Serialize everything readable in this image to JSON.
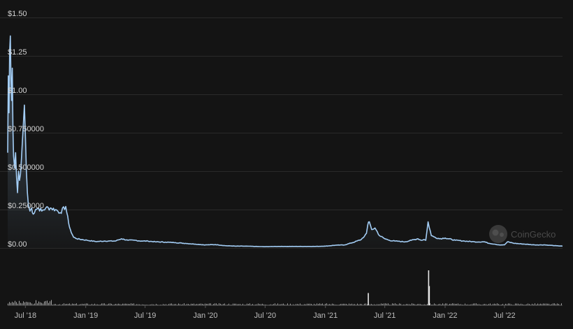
{
  "chart_data": {
    "type": "area",
    "y_tick_labels": [
      "$1.50",
      "$1.25",
      "$1.00",
      "$0.750000",
      "$0.500000",
      "$0.250000",
      "$0.00"
    ],
    "y_tick_values": [
      1.5,
      1.25,
      1.0,
      0.75,
      0.5,
      0.25,
      0.0
    ],
    "ylim": [
      0,
      1.5
    ],
    "x_tick_labels": [
      "Jul '18",
      "Jan '19",
      "Jul '19",
      "Jan '20",
      "Jul '20",
      "Jan '21",
      "Jul '21",
      "Jan '22",
      "Jul '22"
    ],
    "x_tick_values": [
      "2018-07-01",
      "2019-01-01",
      "2019-07-01",
      "2020-01-01",
      "2020-07-01",
      "2021-01-01",
      "2021-07-01",
      "2022-01-01",
      "2022-07-01"
    ],
    "xlim": [
      "2018-05-08",
      "2022-12-25"
    ],
    "grid": true,
    "line_color": "#a3cdf5",
    "volume_color": "#e8e8e8",
    "price_series": {
      "x": [
        "2018-05-08",
        "2018-05-10",
        "2018-05-12",
        "2018-05-14",
        "2018-05-16",
        "2018-05-18",
        "2018-05-20",
        "2018-05-22",
        "2018-05-24",
        "2018-05-26",
        "2018-05-29",
        "2018-06-01",
        "2018-06-04",
        "2018-06-07",
        "2018-06-10",
        "2018-06-13",
        "2018-06-16",
        "2018-06-19",
        "2018-06-22",
        "2018-06-25",
        "2018-06-28",
        "2018-07-01",
        "2018-07-04",
        "2018-07-07",
        "2018-07-10",
        "2018-07-15",
        "2018-07-20",
        "2018-07-25",
        "2018-08-01",
        "2018-08-10",
        "2018-08-20",
        "2018-09-01",
        "2018-09-15",
        "2018-10-01",
        "2018-10-15",
        "2018-11-01",
        "2018-11-10",
        "2018-11-18",
        "2018-11-25",
        "2018-12-05",
        "2018-12-20",
        "2019-01-05",
        "2019-02-01",
        "2019-03-01",
        "2019-04-01",
        "2019-04-20",
        "2019-05-10",
        "2019-06-01",
        "2019-06-20",
        "2019-07-10",
        "2019-08-01",
        "2019-09-01",
        "2019-10-01",
        "2019-11-01",
        "2019-12-01",
        "2020-01-01",
        "2020-02-01",
        "2020-03-01",
        "2020-04-01",
        "2020-05-01",
        "2020-06-01",
        "2020-07-01",
        "2020-08-01",
        "2020-09-01",
        "2020-10-01",
        "2020-11-01",
        "2020-12-01",
        "2021-01-01",
        "2021-02-01",
        "2021-03-01",
        "2021-04-01",
        "2021-04-20",
        "2021-05-01",
        "2021-05-06",
        "2021-05-10",
        "2021-05-15",
        "2021-05-22",
        "2021-06-01",
        "2021-06-15",
        "2021-07-01",
        "2021-07-15",
        "2021-08-01",
        "2021-09-01",
        "2021-09-20",
        "2021-10-10",
        "2021-10-20",
        "2021-10-28",
        "2021-11-03",
        "2021-11-10",
        "2021-11-20",
        "2021-12-01",
        "2021-12-15",
        "2022-01-01",
        "2022-02-01",
        "2022-03-01",
        "2022-04-01",
        "2022-05-01",
        "2022-05-15",
        "2022-06-01",
        "2022-06-15",
        "2022-07-01",
        "2022-07-10",
        "2022-08-01",
        "2022-09-01",
        "2022-10-01",
        "2022-11-01",
        "2022-12-01",
        "2022-12-25"
      ],
      "y": [
        0.62,
        1.12,
        0.88,
        1.28,
        1.38,
        1.1,
        0.96,
        1.17,
        0.78,
        0.6,
        0.52,
        0.62,
        0.46,
        0.36,
        0.5,
        0.44,
        0.48,
        0.58,
        0.7,
        0.81,
        0.93,
        0.74,
        0.51,
        0.36,
        0.28,
        0.24,
        0.26,
        0.22,
        0.25,
        0.26,
        0.24,
        0.26,
        0.26,
        0.25,
        0.23,
        0.27,
        0.16,
        0.1,
        0.07,
        0.06,
        0.055,
        0.05,
        0.042,
        0.045,
        0.045,
        0.06,
        0.05,
        0.05,
        0.045,
        0.045,
        0.04,
        0.038,
        0.035,
        0.03,
        0.025,
        0.02,
        0.022,
        0.015,
        0.012,
        0.012,
        0.01,
        0.008,
        0.01,
        0.01,
        0.01,
        0.01,
        0.01,
        0.012,
        0.018,
        0.02,
        0.04,
        0.055,
        0.08,
        0.095,
        0.15,
        0.17,
        0.12,
        0.13,
        0.08,
        0.06,
        0.05,
        0.045,
        0.04,
        0.05,
        0.06,
        0.05,
        0.055,
        0.05,
        0.17,
        0.08,
        0.07,
        0.06,
        0.065,
        0.05,
        0.045,
        0.04,
        0.04,
        0.03,
        0.025,
        0.02,
        0.02,
        0.04,
        0.03,
        0.025,
        0.02,
        0.02,
        0.015,
        0.012
      ]
    },
    "volume_spikes": {
      "x": [
        "2021-05-10",
        "2021-11-10",
        "2021-11-12"
      ],
      "relative_height": [
        0.35,
        1.0,
        0.55
      ]
    }
  }
}
